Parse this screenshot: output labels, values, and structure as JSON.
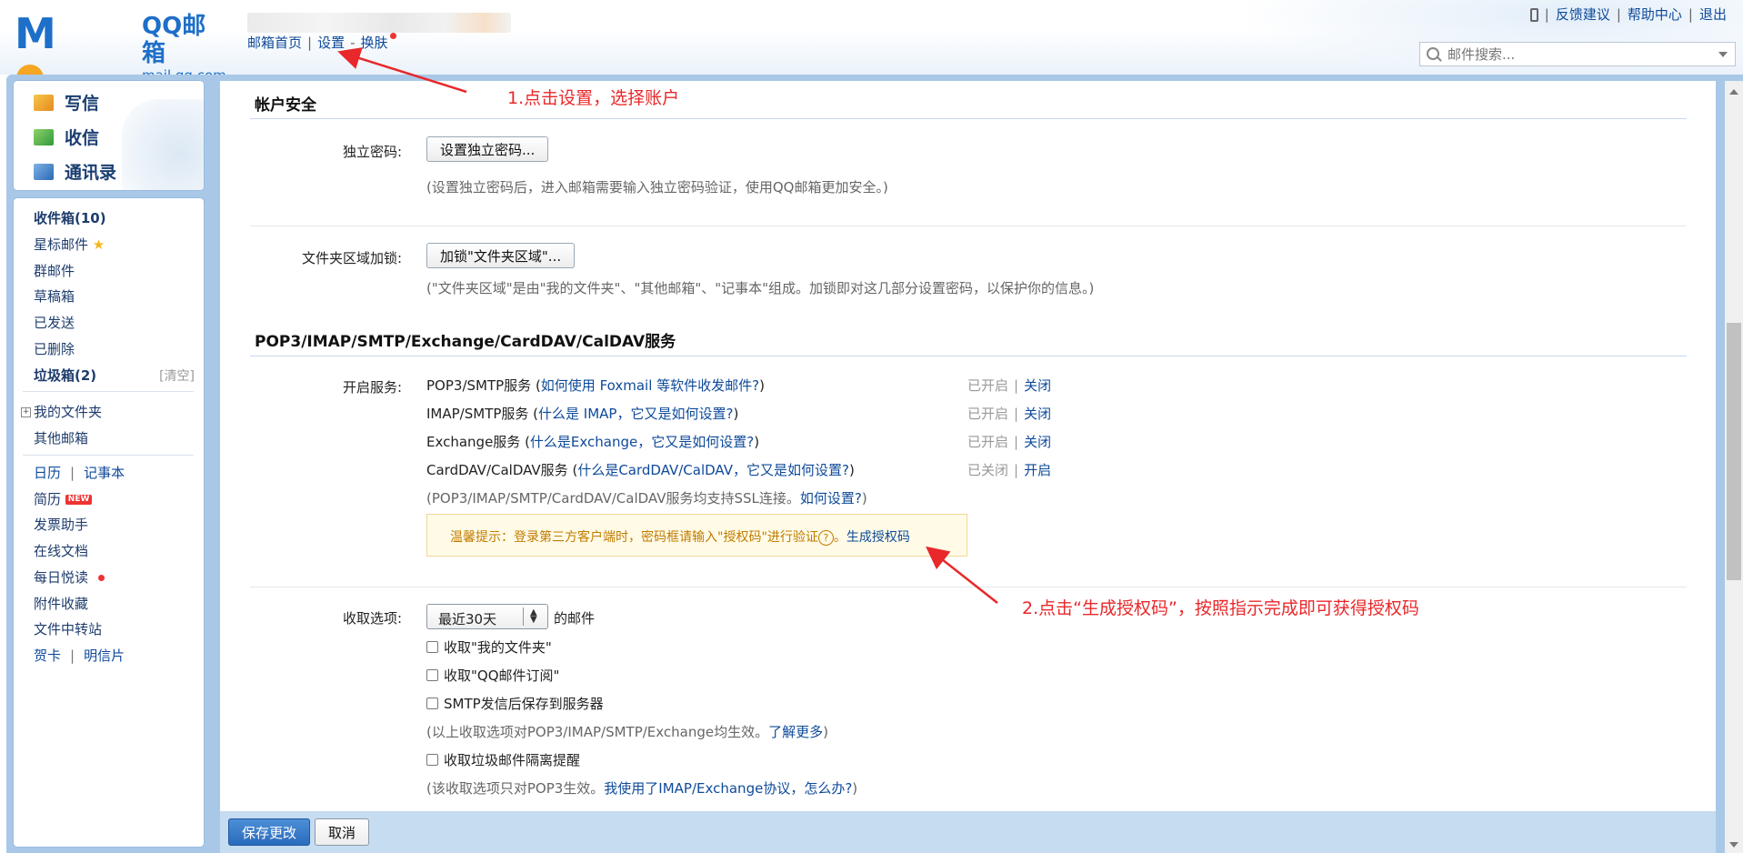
{
  "header": {
    "logo_text": "MOil",
    "logo_title": "QQ邮箱",
    "logo_domain": "mail.qq.com",
    "nav": {
      "home": "邮箱首页",
      "settings": "设置",
      "dash": "-",
      "skin": "换肤"
    },
    "links": {
      "feedback": "反馈建议",
      "help": "帮助中心",
      "logout": "退出"
    },
    "search_placeholder": "邮件搜索..."
  },
  "quick_actions": {
    "compose": "写信",
    "receive": "收信",
    "contacts": "通讯录"
  },
  "sidebar": {
    "inbox": "收件箱(10)",
    "starred": "星标邮件",
    "group": "群邮件",
    "drafts": "草稿箱",
    "sent": "已发送",
    "deleted": "已删除",
    "spam": "垃圾箱(2)",
    "spam_clear": "[清空]",
    "my_folders": "我的文件夹",
    "other_mail": "其他邮箱",
    "calendar": "日历",
    "notes": "记事本",
    "resume": "简历",
    "resume_badge": "NEW",
    "invoice": "发票助手",
    "online_docs": "在线文档",
    "daily": "每日悦读",
    "attachments": "附件收藏",
    "file_transfer": "文件中转站",
    "greeting": "贺卡",
    "postcard": "明信片"
  },
  "content": {
    "account_security_title": "帐户安全",
    "standalone_pwd_label": "独立密码:",
    "standalone_pwd_button": "设置独立密码...",
    "standalone_pwd_hint": "(设置独立密码后，进入邮箱需要输入独立密码验证，使用QQ邮箱更加安全。)",
    "folder_lock_label": "文件夹区域加锁:",
    "folder_lock_button": "加锁\"文件夹区域\"...",
    "folder_lock_hint": "(\"文件夹区域\"是由\"我的文件夹\"、\"其他邮箱\"、\"记事本\"组成。加锁即对这几部分设置密码，以保护你的信息。)",
    "services_title": "POP3/IMAP/SMTP/Exchange/CardDAV/CalDAV服务",
    "enable_label": "开启服务:",
    "services": [
      {
        "name": "POP3/SMTP服务",
        "open": " (",
        "help": "如何使用 Foxmail 等软件收发邮件?",
        "close": ")",
        "status": "已开启",
        "action": "关闭"
      },
      {
        "name": "IMAP/SMTP服务",
        "open": " (",
        "help": "什么是 IMAP，它又是如何设置?",
        "close": ")",
        "status": "已开启",
        "action": "关闭"
      },
      {
        "name": "Exchange服务",
        "open": " (",
        "help": "什么是Exchange，它又是如何设置?",
        "close": ")",
        "status": "已开启",
        "action": "关闭"
      },
      {
        "name": "CardDAV/CalDAV服务",
        "open": " (",
        "help": "什么是CardDAV/CalDAV，它又是如何设置?",
        "close": ")",
        "status": "已关闭",
        "action": "开启"
      }
    ],
    "ssl_hint": "(POP3/IMAP/SMTP/CardDAV/CalDAV服务均支持SSL连接。",
    "ssl_link": "如何设置?",
    "ssl_close": ")",
    "tip_text": "温馨提示：登录第三方客户端时，密码框请输入\"授权码\"进行验证",
    "tip_q": "?",
    "tip_after": "。",
    "tip_link": "生成授权码",
    "receive_label": "收取选项:",
    "receive_select": "最近30天",
    "receive_suffix": "的邮件",
    "opt_my_folders": "收取\"我的文件夹\"",
    "opt_qq_sub": "收取\"QQ邮件订阅\"",
    "opt_smtp_save": "SMTP发信后保存到服务器",
    "opt_hint": "(以上收取选项对POP3/IMAP/SMTP/Exchange均生效。",
    "opt_hint_link": "了解更多",
    "opt_hint_close": ")",
    "opt_spam": "收取垃圾邮件隔离提醒",
    "opt_spam_hint": "(该收取选项只对POP3生效。",
    "opt_spam_link": "我使用了IMAP/Exchange协议，怎么办?",
    "opt_spam_close": ")"
  },
  "footer": {
    "save": "保存更改",
    "cancel": "取消"
  },
  "annotations": {
    "step1": "1.点击设置，选择账户",
    "step2": "2.点击“生成授权码”，按照指示完成即可获得授权码"
  },
  "colors": {
    "annotation": "#e8282a",
    "link": "#0e4a9a",
    "frame": "#a9c8e8",
    "primary_button": "#2a6bbd"
  }
}
